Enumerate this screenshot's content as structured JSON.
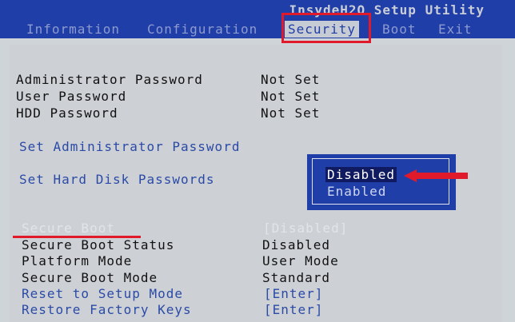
{
  "title": "InsydeH2O Setup Utility",
  "tabs": [
    {
      "label": "Information"
    },
    {
      "label": "Configuration"
    },
    {
      "label": "Security"
    },
    {
      "label": "Boot"
    },
    {
      "label": "Exit"
    }
  ],
  "active_tab": "Security",
  "passwords": [
    {
      "label": "Administrator Password",
      "value": "Not Set"
    },
    {
      "label": "User Password",
      "value": "Not Set"
    },
    {
      "label": "HDD Password",
      "value": "Not Set"
    }
  ],
  "set_admin_password": "Set Administrator Password",
  "set_hdd_passwords": "Set Hard Disk Passwords",
  "secure_boot": {
    "label": "Secure Boot",
    "value": "[Disabled]"
  },
  "status_rows": [
    {
      "label": "Secure Boot Status",
      "value": "Disabled"
    },
    {
      "label": "Platform Mode",
      "value": "User Mode"
    },
    {
      "label": "Secure Boot Mode",
      "value": "Standard"
    }
  ],
  "action_rows": [
    {
      "label": "Reset to Setup Mode",
      "value": "[Enter]"
    },
    {
      "label": "Restore Factory Keys",
      "value": "[Enter]"
    }
  ],
  "popup": {
    "options": [
      "Disabled",
      "Enabled"
    ],
    "selected": "Disabled"
  },
  "colors": {
    "bios_blue": "#1f3ea8",
    "screen_gray": "#cdd1d6",
    "annotation_red": "#e0192b",
    "link_blue": "#2b4aa6"
  }
}
